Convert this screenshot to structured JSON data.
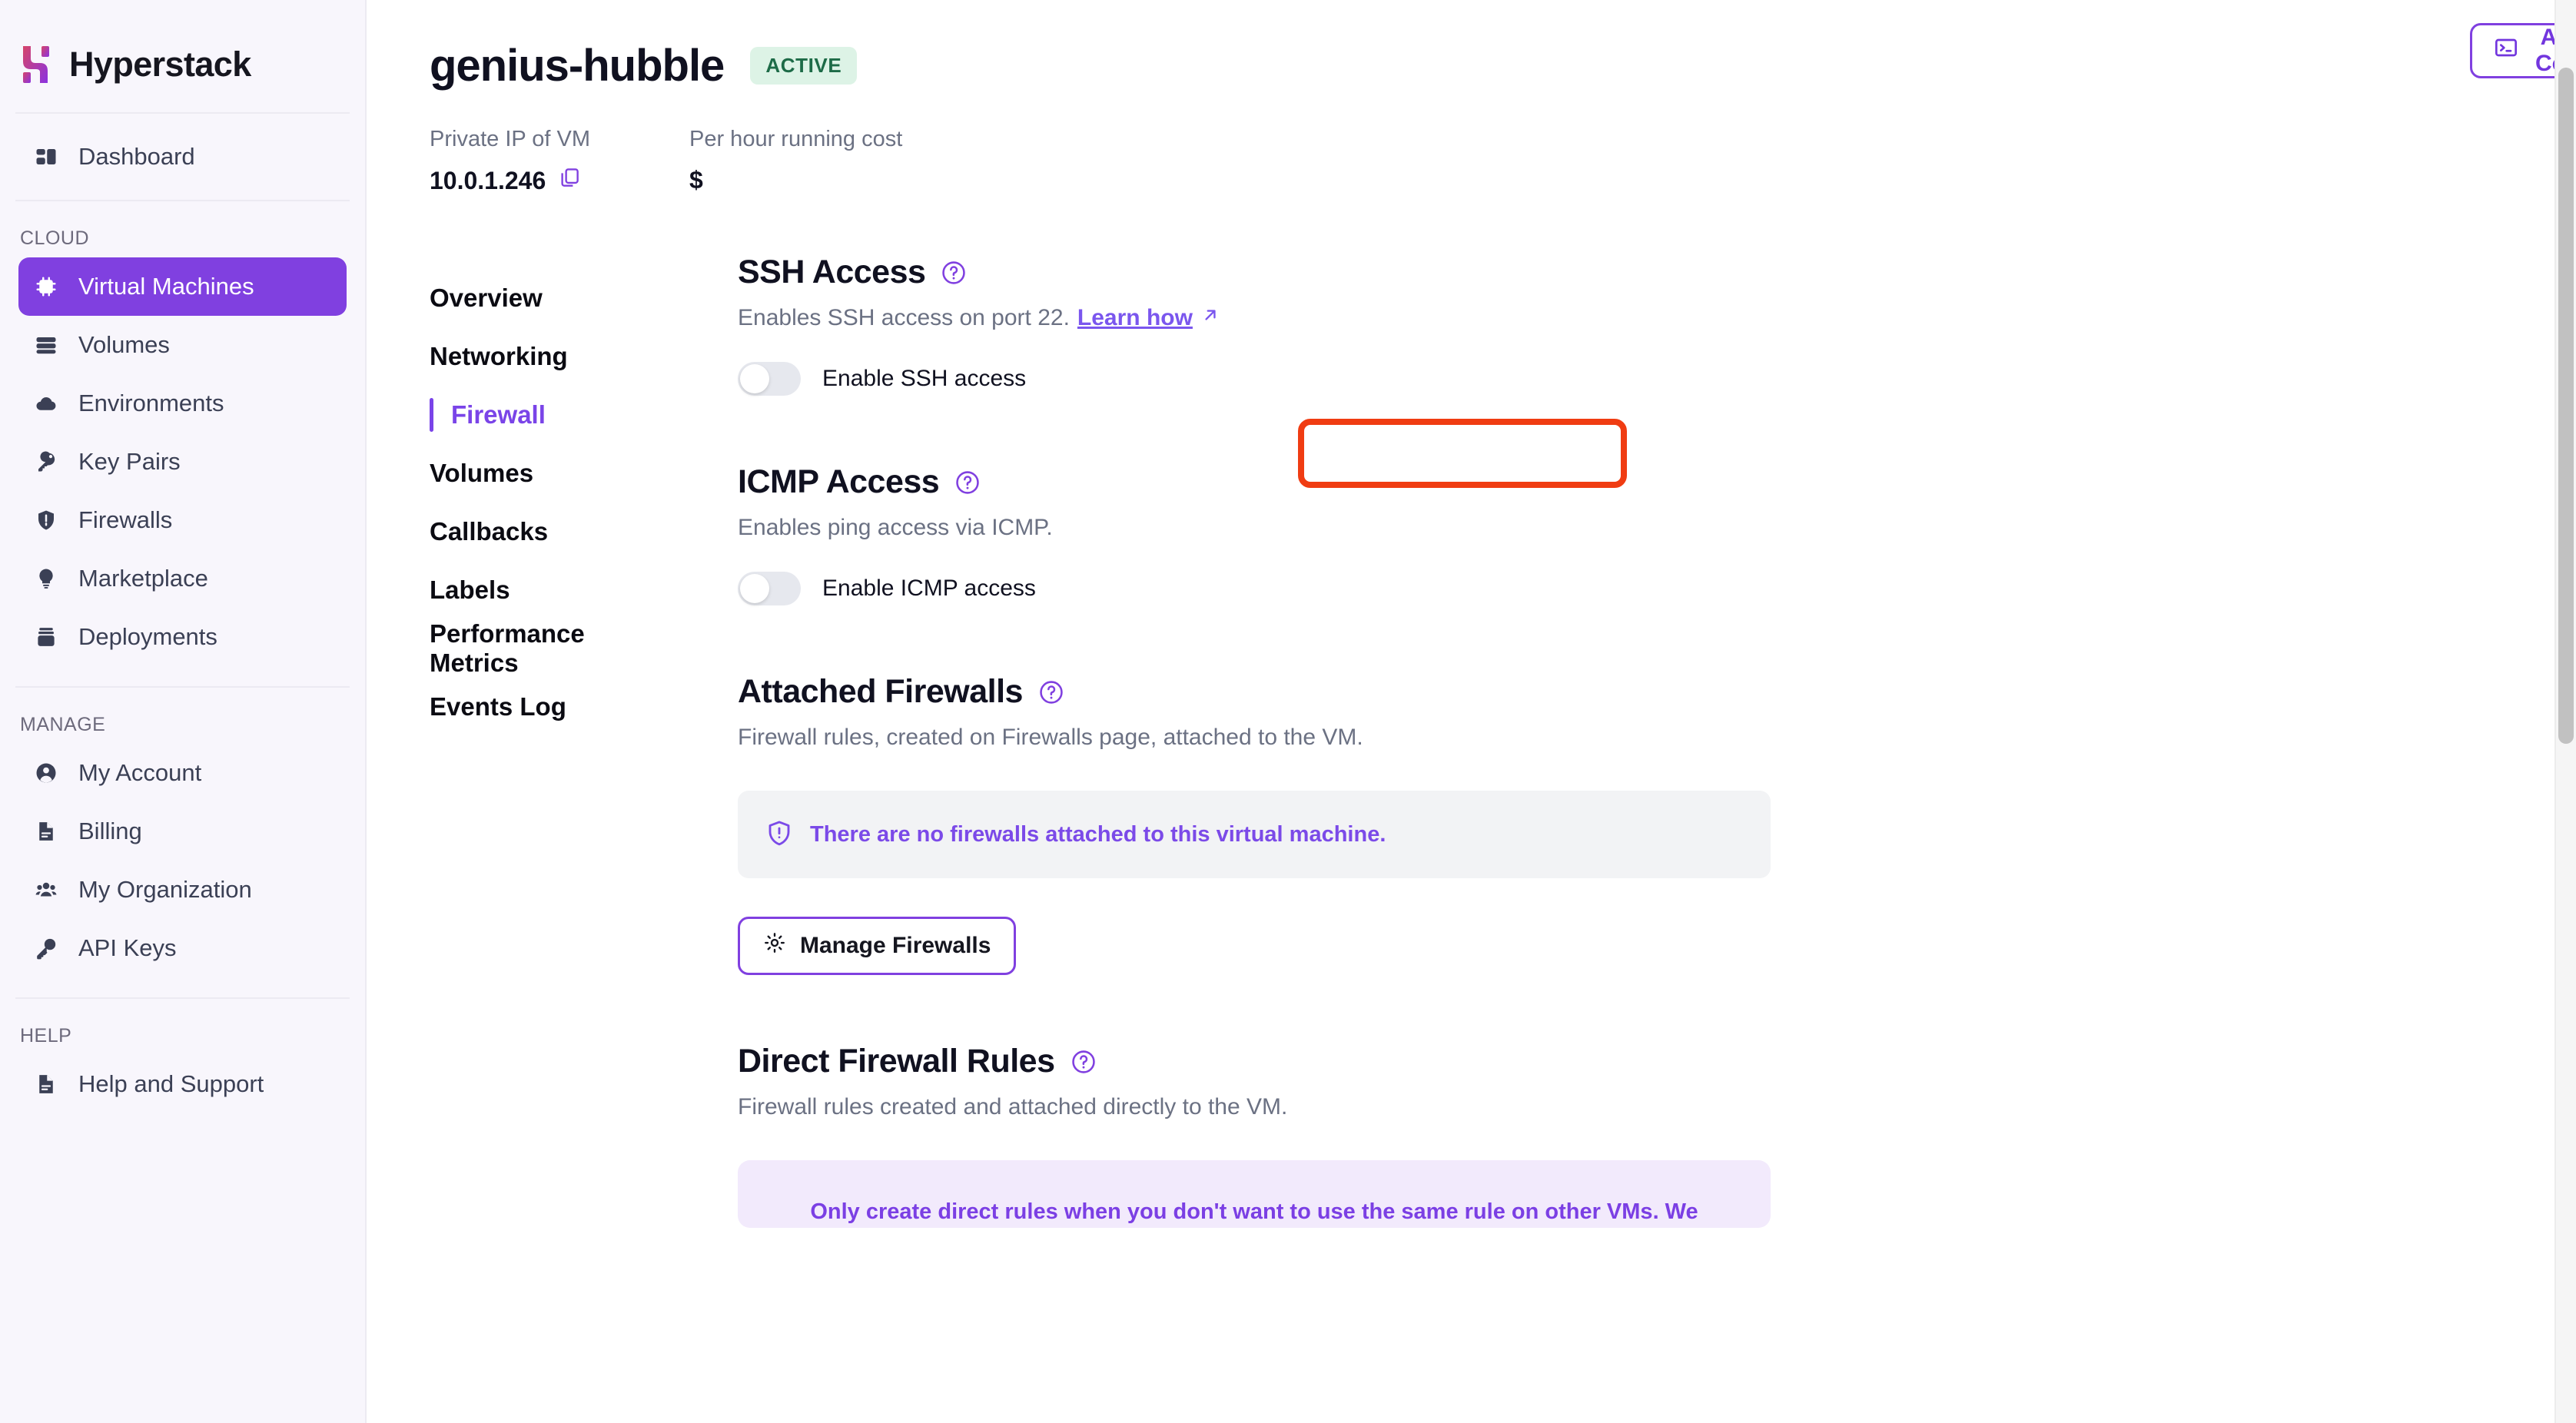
{
  "brand": {
    "name": "Hyperstack",
    "logo_icon": "hyperstack-logo-icon"
  },
  "sidebar": {
    "top_items": [
      {
        "label": "Dashboard",
        "icon": "dashboard-icon"
      }
    ],
    "sections": [
      {
        "label": "CLOUD",
        "items": [
          {
            "label": "Virtual Machines",
            "icon": "cpu-chip-icon",
            "active": true
          },
          {
            "label": "Volumes",
            "icon": "server-stack-icon",
            "active": false
          },
          {
            "label": "Environments",
            "icon": "cloud-icon",
            "active": false
          },
          {
            "label": "Key Pairs",
            "icon": "key-icon",
            "active": false
          },
          {
            "label": "Firewalls",
            "icon": "shield-alert-icon",
            "active": false
          },
          {
            "label": "Marketplace",
            "icon": "lightbulb-icon",
            "active": false
          },
          {
            "label": "Deployments",
            "icon": "deployments-icon",
            "active": false
          }
        ]
      },
      {
        "label": "MANAGE",
        "items": [
          {
            "label": "My Account",
            "icon": "user-circle-icon",
            "active": false
          },
          {
            "label": "Billing",
            "icon": "document-icon",
            "active": false
          },
          {
            "label": "My Organization",
            "icon": "users-group-icon",
            "active": false
          },
          {
            "label": "API Keys",
            "icon": "key-outline-icon",
            "active": false
          }
        ]
      },
      {
        "label": "HELP",
        "items": [
          {
            "label": "Help and Support",
            "icon": "document-icon",
            "active": false
          }
        ]
      }
    ]
  },
  "topbar": {
    "access_console_label": "Access Console",
    "access_console_icon": "terminal-icon",
    "kebab_icon": "more-vertical-icon"
  },
  "header": {
    "vm_name": "genius-hubble",
    "status_badge": "ACTIVE",
    "meta": [
      {
        "label": "Private IP of VM",
        "value": "10.0.1.246",
        "icon": "copy-icon"
      },
      {
        "label": "Per hour running cost",
        "value": "$",
        "icon": ""
      }
    ]
  },
  "section_nav": [
    {
      "label": "Overview",
      "active": false
    },
    {
      "label": "Networking",
      "active": false
    },
    {
      "label": "Firewall",
      "active": true
    },
    {
      "label": "Volumes",
      "active": false
    },
    {
      "label": "Callbacks",
      "active": false
    },
    {
      "label": "Labels",
      "active": false
    },
    {
      "label": "Performance Metrics",
      "active": false
    },
    {
      "label": "Events Log",
      "active": false
    }
  ],
  "ssh": {
    "title": "SSH Access",
    "help_icon": "question-circle-icon",
    "description": "Enables SSH access on port 22.",
    "link_label": "Learn how",
    "link_icon": "external-link-icon",
    "toggle_label": "Enable SSH access",
    "toggle_on": false
  },
  "icmp": {
    "title": "ICMP Access",
    "help_icon": "question-circle-icon",
    "description": "Enables ping access via ICMP.",
    "toggle_label": "Enable ICMP access",
    "toggle_on": false
  },
  "attached_firewalls": {
    "title": "Attached Firewalls",
    "help_icon": "question-circle-icon",
    "description": "Firewall rules, created on Firewalls page, attached to the VM.",
    "empty_message": "There are no firewalls attached to this virtual machine.",
    "empty_icon": "shield-alert-icon",
    "button_label": "Manage Firewalls",
    "button_icon": "gear-icon"
  },
  "direct_rules": {
    "title": "Direct Firewall Rules",
    "help_icon": "question-circle-icon",
    "description": "Firewall rules created and attached directly to the VM.",
    "warning": "Only create direct rules when you don't want to use the same rule on other VMs. We"
  },
  "colors": {
    "accent_purple": "#8040e0",
    "link_purple": "#7a56ee",
    "badge_bg": "#ddf3e6",
    "badge_text": "#1d6b47",
    "highlight_red": "#f03c12",
    "sidebar_bg": "#f8f6fc"
  }
}
